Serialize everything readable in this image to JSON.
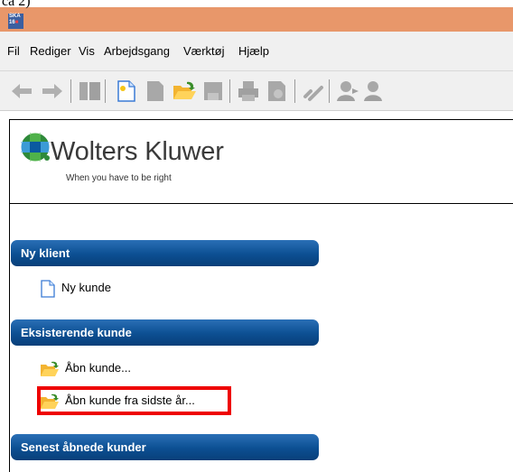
{
  "caption": "ca 2)",
  "title_bar": {
    "app_icon_label": "SKA 16"
  },
  "menu": {
    "items": [
      "Fil",
      "Rediger",
      "Vis",
      "Arbejdsgang",
      "Værktøj",
      "Hjælp"
    ]
  },
  "toolbar": {
    "icons": [
      "back-arrow-icon",
      "forward-arrow-icon",
      "book-icon",
      "new-document-icon",
      "document-icon",
      "open-folder-icon",
      "save-icon",
      "print-icon",
      "print-preview-icon",
      "link-icon",
      "user-icon",
      "users-icon"
    ]
  },
  "brand": {
    "name": "Wolters Kluwer",
    "tagline": "When you have to be right"
  },
  "sections": {
    "new_client": {
      "header": "Ny klient",
      "items": [
        {
          "label": "Ny kunde",
          "icon": "new-document-icon"
        }
      ]
    },
    "existing_customer": {
      "header": "Eksisterende kunde",
      "items": [
        {
          "label": "Åbn kunde...",
          "icon": "open-folder-icon"
        },
        {
          "label": "Åbn kunde fra sidste år...",
          "icon": "open-folder-icon"
        }
      ]
    },
    "recent_customers": {
      "header": "Senest åbnede kunder"
    }
  },
  "colors": {
    "title_bar": "#e8976a",
    "section_header": "#0c4f92",
    "highlight": "#ee0000"
  }
}
